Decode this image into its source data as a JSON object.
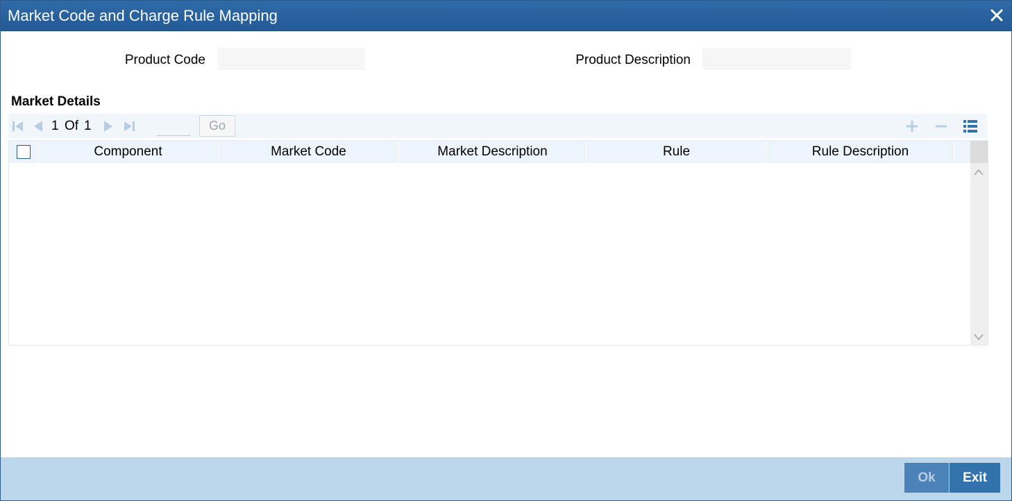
{
  "window": {
    "title": "Market Code and Charge Rule Mapping"
  },
  "fields": {
    "product_code": {
      "label": "Product Code",
      "value": ""
    },
    "product_description": {
      "label": "Product Description",
      "value": ""
    }
  },
  "market_details": {
    "section_title": "Market Details",
    "pagination": {
      "current": "1",
      "of_label": "Of",
      "total": "1",
      "go_label": "Go",
      "page_input": ""
    },
    "columns": [
      "Component",
      "Market Code",
      "Market Description",
      "Rule",
      "Rule Description"
    ],
    "rows": []
  },
  "footer": {
    "ok_label": "Ok",
    "exit_label": "Exit"
  },
  "icons": {
    "close": "close-icon",
    "first_page": "first-page-icon",
    "prev_page": "prev-page-icon",
    "next_page": "next-page-icon",
    "last_page": "last-page-icon",
    "add_row": "plus-icon",
    "delete_row": "minus-icon",
    "single_view": "list-view-icon"
  },
  "colors": {
    "titlebar": "#2f6aa8",
    "footer": "#bcd7eb",
    "button": "#3273ad"
  }
}
